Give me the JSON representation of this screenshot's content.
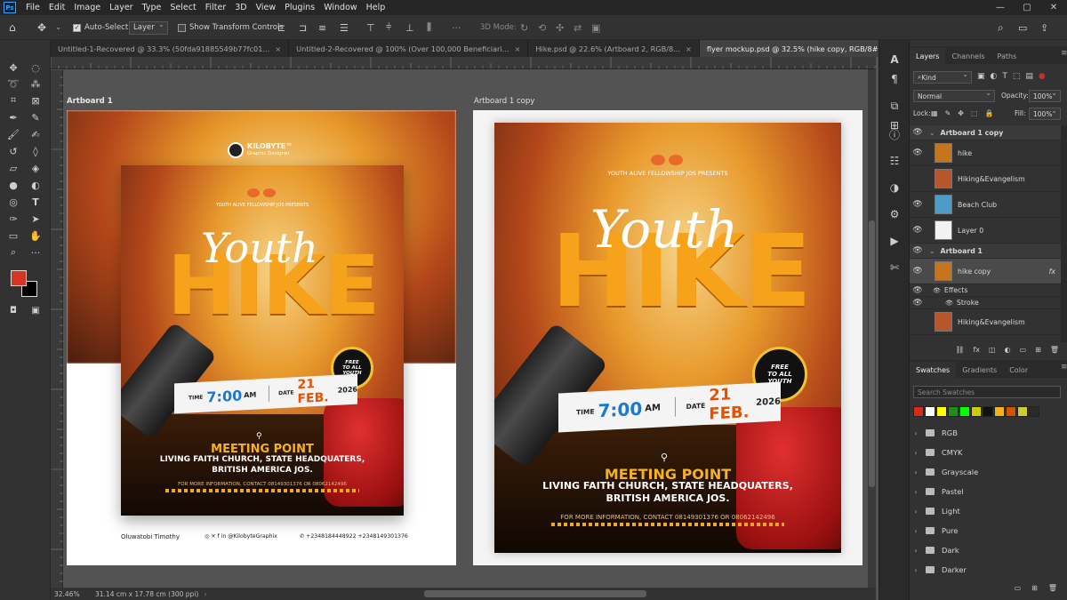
{
  "app": {
    "logo": "Ps"
  },
  "menu": [
    "File",
    "Edit",
    "Image",
    "Layer",
    "Type",
    "Select",
    "Filter",
    "3D",
    "View",
    "Plugins",
    "Window",
    "Help"
  ],
  "options": {
    "auto_select_label": "Auto-Select:",
    "auto_select_value": "Layer",
    "show_transform_label": "Show Transform Controls",
    "mode_3d_label": "3D Mode:"
  },
  "tabs": [
    {
      "label": "Untitled-1-Recovered @ 33.3% (50fda91885549b77fc01...",
      "active": false
    },
    {
      "label": "Untitled-2-Recovered @ 100% (Over 100,000 Beneficiari...",
      "active": false
    },
    {
      "label": "Hike.psd @ 22.6% (Artboard 2, RGB/8...",
      "active": false
    },
    {
      "label": "flyer mockup.psd @ 32.5% (hike copy, RGB/8#) *",
      "active": true
    }
  ],
  "canvas": {
    "artboard1_label": "Artboard 1",
    "artboard2_label": "Artboard 1 copy"
  },
  "flyer": {
    "brand_name": "KILOBYTE™",
    "brand_sub": "Graphic Designer",
    "presenter": "YOUTH ALIVE FELLOWSHIP JOS PRESENTS",
    "script_word": "Youth",
    "title": "HIKE",
    "badge_line1": "FREE",
    "badge_line2": "TO ALL",
    "badge_line3": "YOUTH",
    "time_label": "TIME",
    "time_value": "7:00",
    "time_suffix": "AM",
    "date_label": "DATE",
    "date_value": "21 FEB.",
    "date_year": "2026",
    "meeting_point": "MEETING POINT",
    "address_line1": "LIVING FAITH CHURCH, STATE HEADQUATERS,",
    "address_line2": "BRITISH AMERICA JOS.",
    "contact": "FOR MORE INFORMATION, CONTACT 08149301376 OR 08062142496"
  },
  "mockup_footer": {
    "name": "Oluwatobi Timothy",
    "social": "@KilobyteGraphix",
    "phones": "+2348184448922  +2348149301376"
  },
  "status": {
    "zoom": "32.46%",
    "doc_size": "31.14 cm x 17.78 cm (300 ppi)"
  },
  "layers_panel": {
    "tabs": [
      "Layers",
      "Channels",
      "Paths"
    ],
    "kind_label": "Kind",
    "blend_mode": "Normal",
    "opacity_label": "Opacity:",
    "opacity_value": "100%",
    "lock_label": "Lock:",
    "fill_label": "Fill:",
    "fill_value": "100%",
    "rows": [
      {
        "name": "Artboard 1 copy",
        "type": "group"
      },
      {
        "name": "hike",
        "type": "layer"
      },
      {
        "name": "Hiking&Evangelism",
        "type": "layer",
        "hidden": true
      },
      {
        "name": "Beach Club",
        "type": "layer"
      },
      {
        "name": "Layer 0",
        "type": "layer"
      },
      {
        "name": "Artboard 1",
        "type": "group"
      },
      {
        "name": "hike copy",
        "type": "layer",
        "selected": true
      },
      {
        "name": "Effects",
        "type": "effect"
      },
      {
        "name": "Stroke",
        "type": "effect"
      },
      {
        "name": "Hiking&Evangelism",
        "type": "layer",
        "hidden": true
      }
    ]
  },
  "swatches_panel": {
    "tabs": [
      "Swatches",
      "Gradients",
      "Color"
    ],
    "search_placeholder": "Search Swatches",
    "colors": [
      "#d62b1a",
      "#ffffff",
      "#ffff00",
      "#1a8f1a",
      "#00ff00",
      "#cccc00",
      "#111111",
      "#f2b21b",
      "#d35400",
      "#cccc33",
      "#2a2a2a"
    ],
    "folders": [
      "RGB",
      "CMYK",
      "Grayscale",
      "Pastel",
      "Light",
      "Pure",
      "Dark",
      "Darker"
    ]
  },
  "colors": {
    "foreground": "#d6361f",
    "background": "#000000",
    "accent": "#31a8ff"
  }
}
